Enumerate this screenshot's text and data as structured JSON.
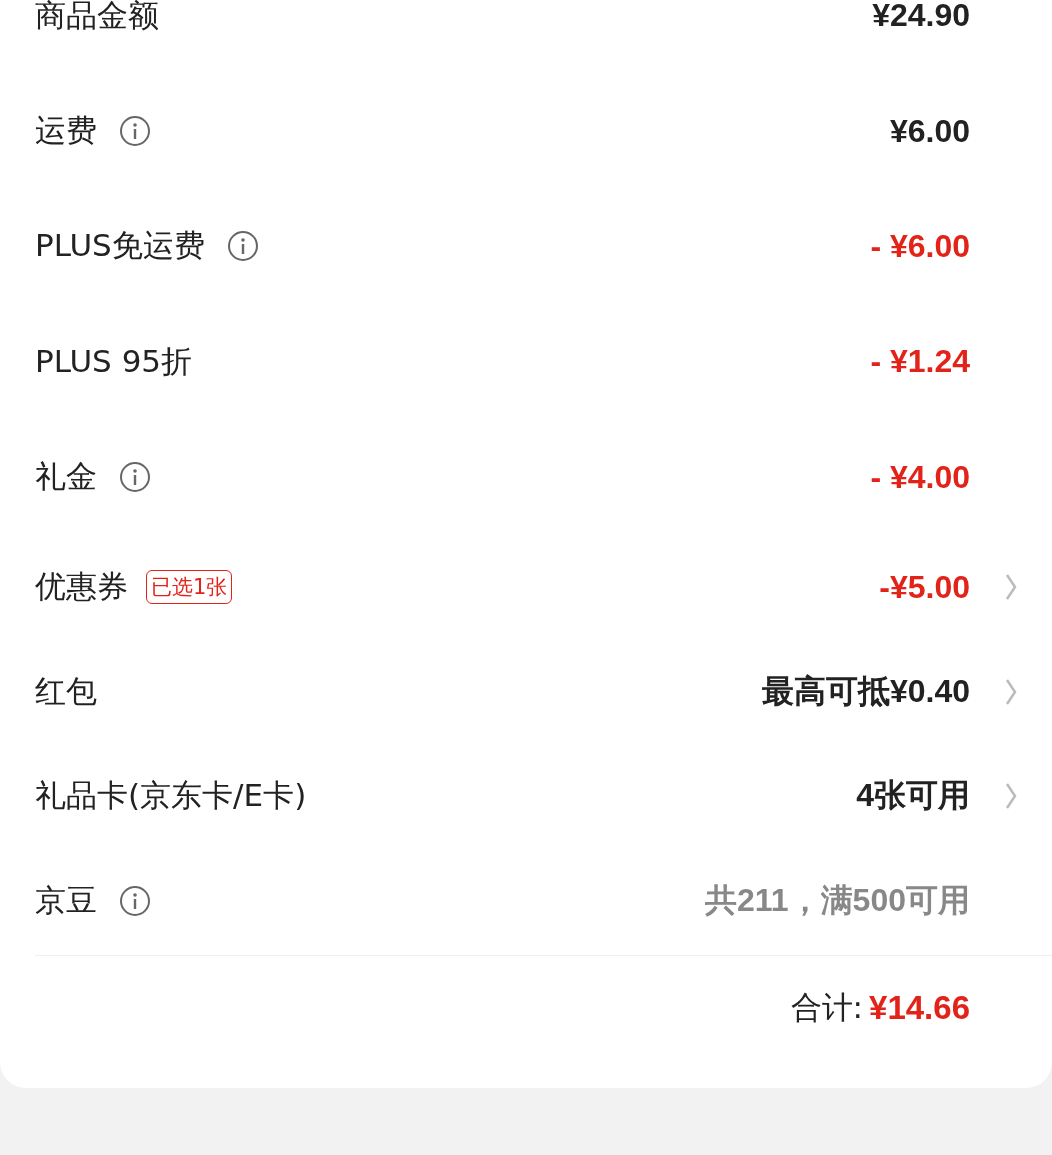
{
  "rows": [
    {
      "label": "商品金额",
      "info": false,
      "value": "¥24.90",
      "color": "#222222",
      "chevron": false
    },
    {
      "label": "运费",
      "info": true,
      "value": "¥6.00",
      "color": "#222222",
      "chevron": false
    },
    {
      "label": "PLUS免运费",
      "info": true,
      "value": "- ¥6.00",
      "color": "#e2231a",
      "chevron": false
    },
    {
      "label": "PLUS 95折",
      "info": false,
      "value": "- ¥1.24",
      "color": "#e2231a",
      "chevron": false
    },
    {
      "label": "礼金",
      "info": true,
      "value": "- ¥4.00",
      "color": "#e2231a",
      "chevron": false
    },
    {
      "label": "优惠券",
      "info": false,
      "badge": "已选1张",
      "value": "-¥5.00",
      "color": "#e2231a",
      "chevron": true
    },
    {
      "label": "红包",
      "info": false,
      "value": "最高可抵¥0.40",
      "color": "#222222",
      "chevron": true
    },
    {
      "label": "礼品卡(京东卡/E卡)",
      "info": false,
      "value": "4张可用",
      "color": "#222222",
      "chevron": true
    },
    {
      "label": "京豆",
      "info": true,
      "value": "共211，满500可用",
      "color": "#888888",
      "chevron": false
    }
  ],
  "total": {
    "label": "合计:",
    "value": "¥14.66"
  }
}
